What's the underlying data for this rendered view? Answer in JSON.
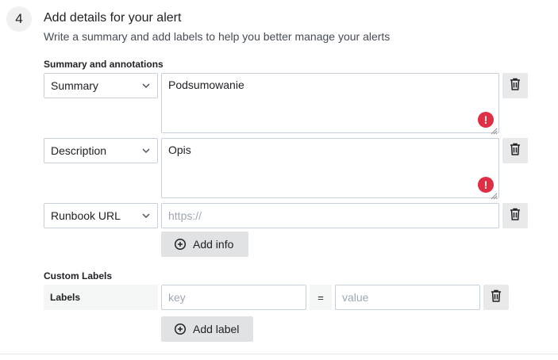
{
  "step": {
    "number": "4",
    "title": "Add details for your alert",
    "subtitle": "Write a summary and add labels to help you better manage your alerts"
  },
  "annotations": {
    "section_label": "Summary and annotations",
    "rows": [
      {
        "key": "Summary",
        "value": "Podsumowanie",
        "error": true
      },
      {
        "key": "Description",
        "value": "Opis",
        "error": true
      },
      {
        "key": "Runbook URL",
        "placeholder": "https://"
      }
    ],
    "add_button": "Add info",
    "error_glyph": "!"
  },
  "custom_labels": {
    "section_label": "Custom Labels",
    "row_label": "Labels",
    "key_placeholder": "key",
    "equals": "=",
    "value_placeholder": "value",
    "add_button": "Add label"
  },
  "icons": {
    "trash": "trash-icon",
    "plus_circle": "plus-circle-icon",
    "chevron": "chevron-down-icon",
    "error": "exclamation-circle-icon"
  },
  "colors": {
    "error": "#e02f44",
    "button_bg": "#e1e2e4"
  }
}
